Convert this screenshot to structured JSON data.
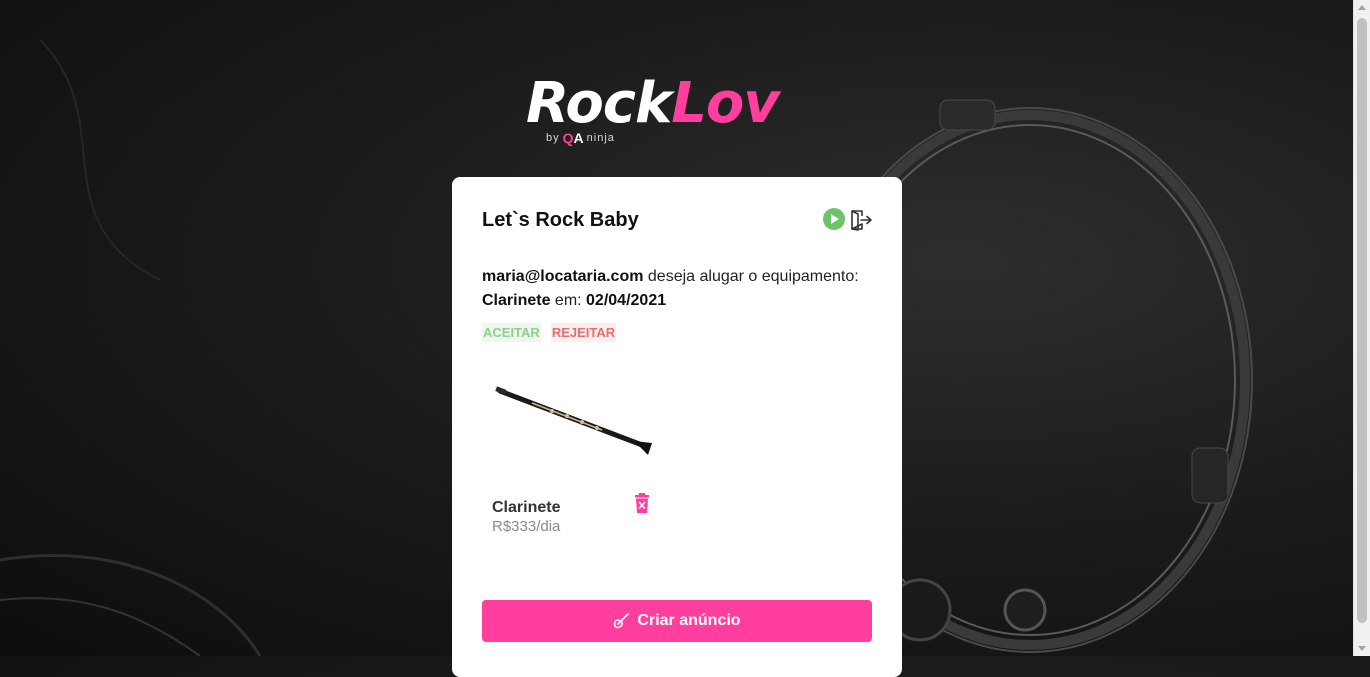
{
  "logo": {
    "rock": "Rock",
    "lov": "Lov",
    "by": "by",
    "qa_q": "Q",
    "qa_a": "A",
    "ninja": "ninja"
  },
  "card": {
    "title": "Let`s Rock Baby",
    "icons": {
      "play": "play-circle-icon",
      "logout": "logout-door-icon"
    }
  },
  "request": {
    "email": "maria@locataria.com",
    "text_middle": " deseja alugar o equipamento:",
    "equipment": "Clarinete",
    "text_date_prefix": " em: ",
    "date": "02/04/2021",
    "accept_label": "ACEITAR",
    "reject_label": "REJEITAR"
  },
  "listing": {
    "name": "Clarinete",
    "price": "R$333/dia",
    "delete_icon": "trash-icon"
  },
  "create_button": {
    "label": "Criar anúncio",
    "icon": "guitar-icon"
  },
  "colors": {
    "brand": "#ff3e9d",
    "accept": "#8fcf8c",
    "reject": "#e46f6f",
    "play": "#6ec26a"
  }
}
